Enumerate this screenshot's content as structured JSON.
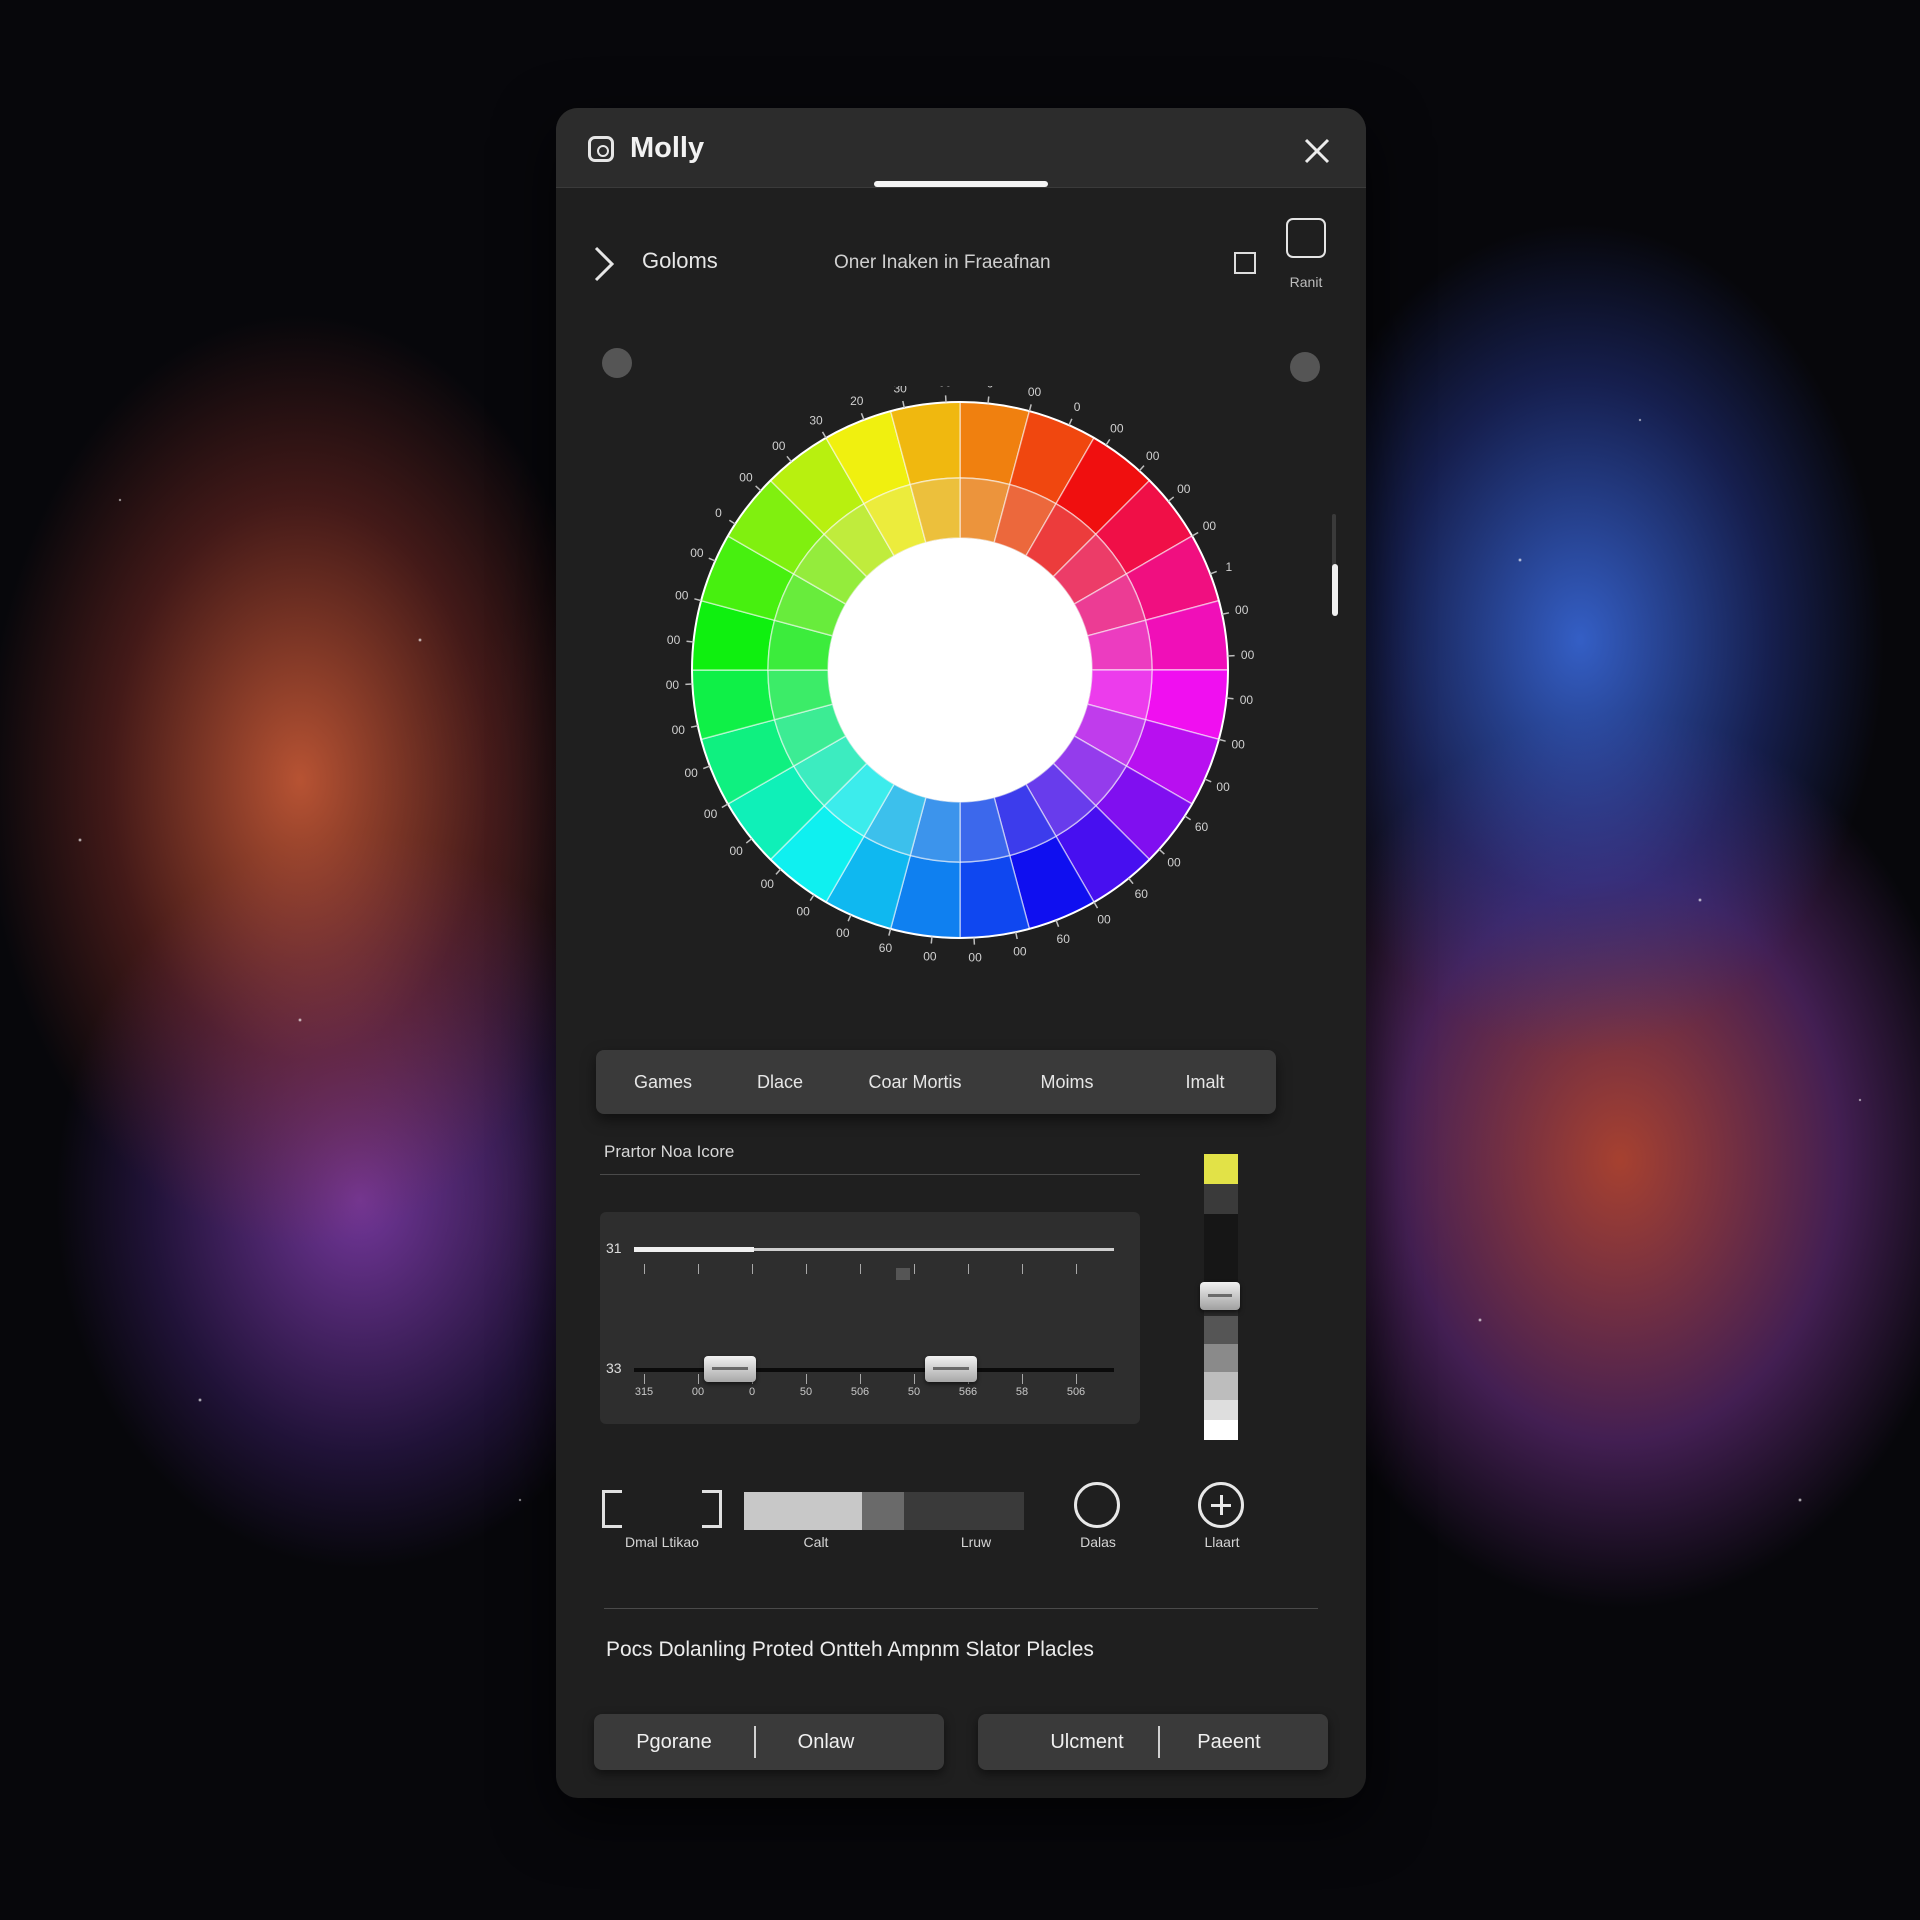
{
  "window": {
    "title": "Molly",
    "close_icon": "close-icon",
    "app_icon": "camera-icon"
  },
  "header": {
    "label": "Goloms",
    "subtitle": "Oner Inaken in Fraeafnan",
    "reset_label": "Ranit"
  },
  "color_wheel": {
    "hues": [
      0,
      15,
      30,
      45,
      60,
      75,
      90,
      105,
      120,
      135,
      150,
      165,
      180,
      195,
      210,
      225,
      240,
      255,
      270,
      285,
      300,
      315,
      330,
      345
    ],
    "center_color": "#ffffff",
    "tick_labels": [
      "0",
      "00",
      "0",
      "00",
      "00",
      "00",
      "00",
      "1",
      "00",
      "00",
      "00",
      "00",
      "00",
      "60",
      "00",
      "60",
      "00",
      "60",
      "00",
      "00",
      "00",
      "60",
      "00",
      "00",
      "00",
      "00",
      "00",
      "00",
      "00",
      "00",
      "00",
      "00",
      "00",
      "0",
      "00",
      "00",
      "30",
      "20",
      "30",
      "00"
    ]
  },
  "tabs": [
    "Games",
    "Dlace",
    "Coar Mortis",
    "Moims",
    "Imalt"
  ],
  "section": {
    "title": "Prartor Noa Icore"
  },
  "slider_box": {
    "row1_label": "31",
    "row1_value": 0.25,
    "row2_label": "33",
    "knob_positions": [
      0.2,
      0.66
    ],
    "tick_labels": [
      "315",
      "00",
      "0",
      "50",
      "506",
      "50",
      "566",
      "58",
      "506"
    ]
  },
  "vertical_slider": {
    "value": 0.45,
    "accent": "#e2e247"
  },
  "controls": {
    "bracket_label": "Dmal Ltikao",
    "bar_label_left": "Calt",
    "bar_label_right": "Lruw",
    "circle_label": "Dalas",
    "plus_label": "Llaart",
    "plus_icon": "plus-circle-icon"
  },
  "footer": {
    "text": "Pocs Dolanling Proted Ontteh Ampnm Slator Placles"
  },
  "buttons": {
    "left": [
      "Pgorane",
      "Onlaw"
    ],
    "right": [
      "Ulcment",
      "Paeent"
    ]
  }
}
